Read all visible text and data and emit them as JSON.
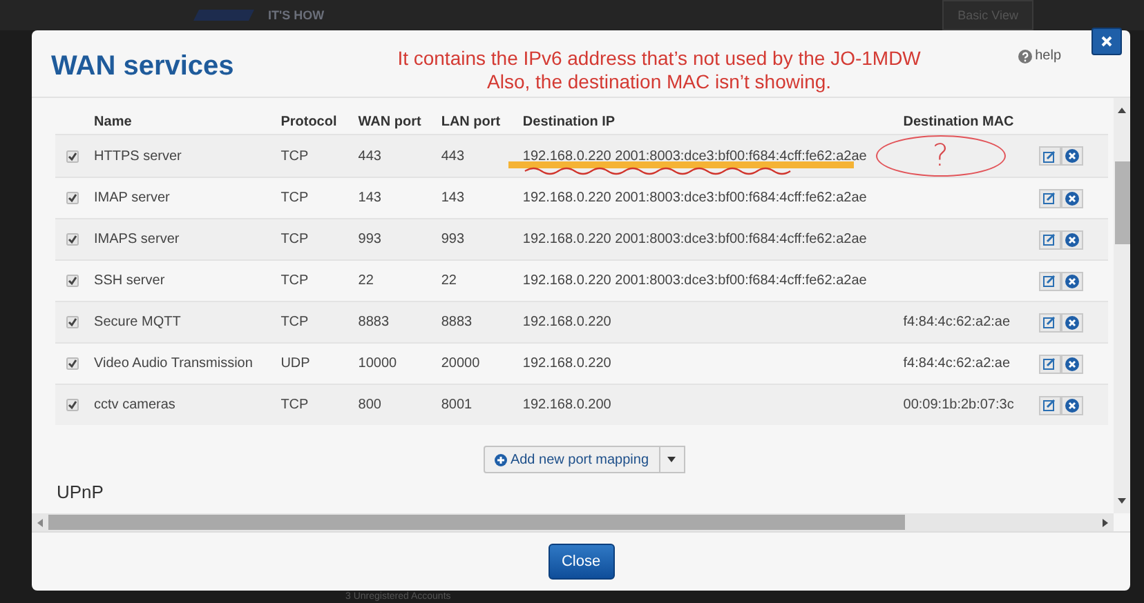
{
  "background": {
    "brand": "IT'S HOW",
    "view_button": "Basic View",
    "footer_text": "3 Unregistered Accounts"
  },
  "dialog": {
    "title": "WAN services",
    "note": [
      "It contains the IPv6 address that’s not used by the JO-1MDW",
      "Also, the destination MAC isn’t showing."
    ],
    "help": "help",
    "table": {
      "columns": [
        "Name",
        "Protocol",
        "WAN port",
        "LAN port",
        "Destination IP",
        "Destination MAC"
      ],
      "rows": [
        {
          "checked": true,
          "cells": [
            "HTTPS server",
            "TCP",
            "443",
            "443",
            "192.168.0.220 2001:8003:dce3:bf00:f684:4cff:fe62:a2ae",
            ""
          ],
          "mac_note": "?",
          "ip_highlighted": true
        },
        {
          "checked": true,
          "cells": [
            "IMAP server",
            "TCP",
            "143",
            "143",
            "192.168.0.220 2001:8003:dce3:bf00:f684:4cff:fe62:a2ae",
            ""
          ]
        },
        {
          "checked": true,
          "cells": [
            "IMAPS server",
            "TCP",
            "993",
            "993",
            "192.168.0.220 2001:8003:dce3:bf00:f684:4cff:fe62:a2ae",
            ""
          ]
        },
        {
          "checked": true,
          "cells": [
            "SSH server",
            "TCP",
            "22",
            "22",
            "192.168.0.220 2001:8003:dce3:bf00:f684:4cff:fe62:a2ae",
            ""
          ]
        },
        {
          "checked": true,
          "cells": [
            "Secure MQTT",
            "TCP",
            "8883",
            "8883",
            "192.168.0.220",
            "f4:84:4c:62:a2:ae"
          ]
        },
        {
          "checked": true,
          "cells": [
            "Video Audio Transmission",
            "UDP",
            "10000",
            "20000",
            "192.168.0.220",
            "f4:84:4c:62:a2:ae"
          ]
        },
        {
          "checked": true,
          "cells": [
            "cctv cameras",
            "TCP",
            "800",
            "8001",
            "192.168.0.200",
            "00:09:1b:2b:07:3c"
          ]
        }
      ]
    },
    "add_button": "Add new port mapping",
    "section": "UPnP",
    "close_button": "Close"
  }
}
